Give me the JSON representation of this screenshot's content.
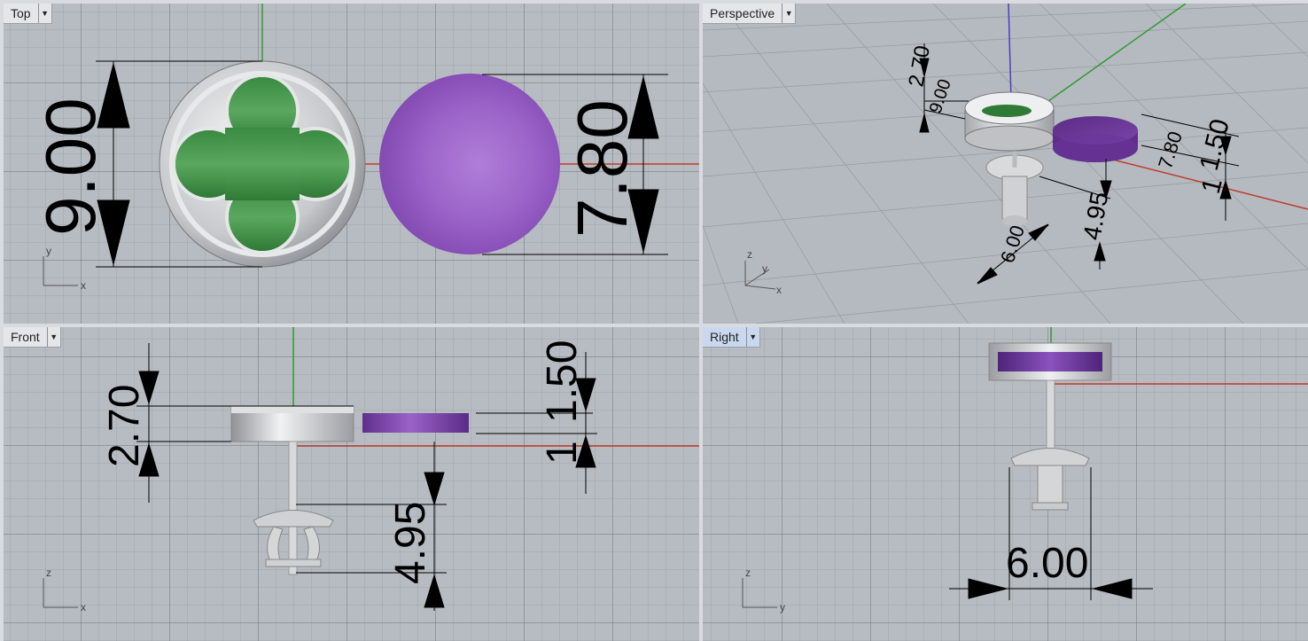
{
  "viewports": {
    "top": {
      "title": "Top"
    },
    "perspective": {
      "title": "Perspective"
    },
    "front": {
      "title": "Front"
    },
    "right": {
      "title": "Right"
    }
  },
  "icons": {
    "viewport_menu": "chevron-down-icon"
  },
  "axes": {
    "top": {
      "v": "y",
      "h": "x"
    },
    "perspective": {
      "z": "z",
      "y": "y",
      "x": "x"
    },
    "front": {
      "v": "z",
      "h": "x"
    },
    "right": {
      "v": "z",
      "h": "y"
    }
  },
  "dimensions": {
    "top": {
      "outer_diameter": "9.00",
      "stone_diameter": "7.80"
    },
    "perspective": {
      "height": "2.70",
      "diameter": "9.00",
      "stone_diameter": "7.80",
      "stone_height": "1.50",
      "offset": "1",
      "post_length": "4.95",
      "back_width": "6.00"
    },
    "front": {
      "setting_height": "2.70",
      "stone_height": "1.50",
      "offset": "1",
      "post_length": "4.95"
    },
    "right": {
      "back_width": "6.00"
    }
  },
  "colors": {
    "viewport_bg": "#b7bcc2",
    "x_axis": "#c0392b",
    "y_axis": "#2e9c2e",
    "z_axis": "#4a3cc8",
    "gem_purple": "#9a62c8",
    "clover_green": "#3f8f45",
    "metal_silver": "#cfd1d4"
  }
}
